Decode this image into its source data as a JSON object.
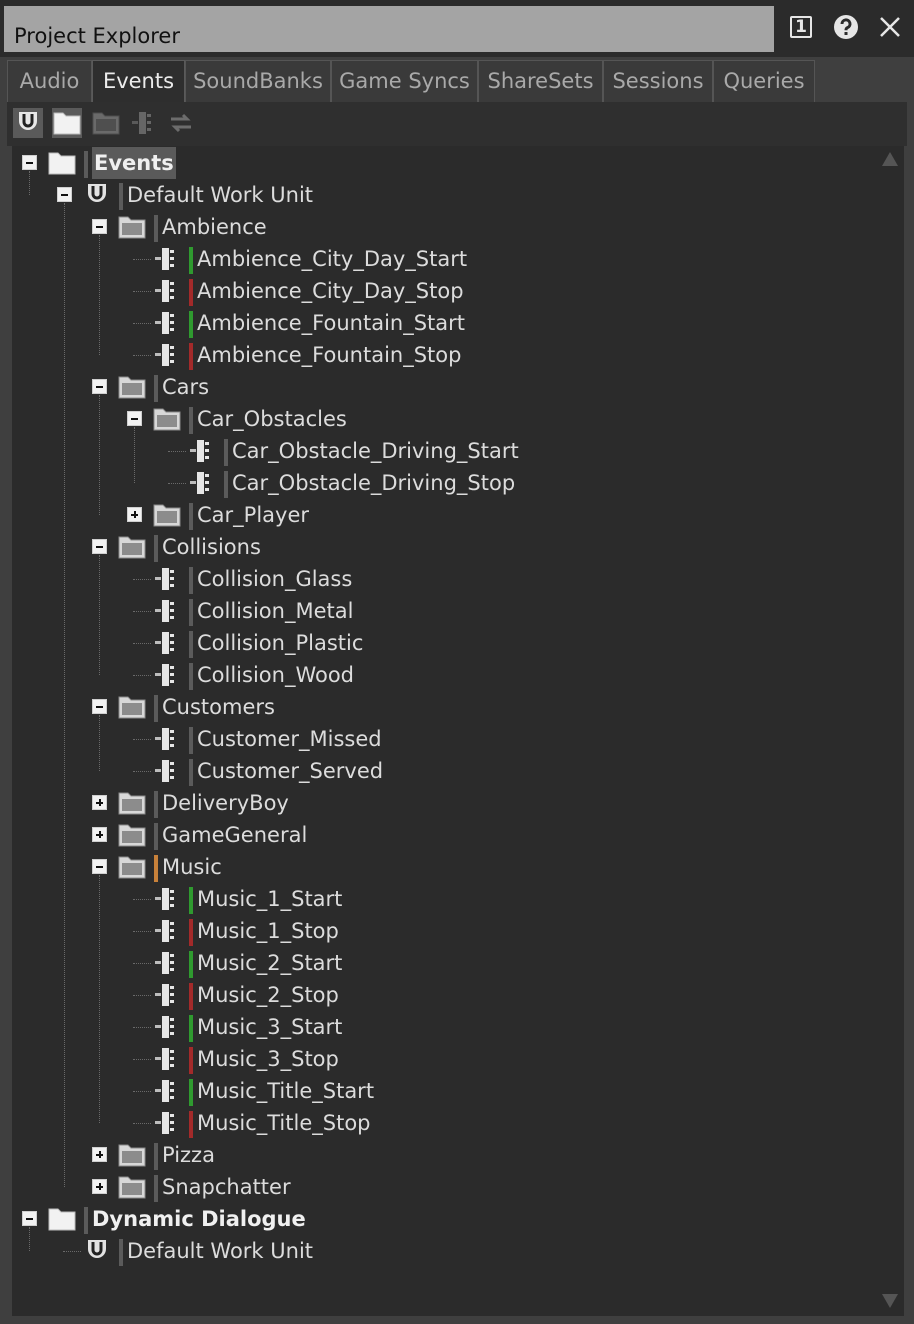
{
  "window": {
    "title": "Project Explorer",
    "float_badge": "1"
  },
  "tabs": [
    "Audio",
    "Events",
    "SoundBanks",
    "Game Syncs",
    "ShareSets",
    "Sessions",
    "Queries"
  ],
  "active_tab": "Events",
  "tree": {
    "events_root": "Events",
    "default_work_unit": "Default Work Unit",
    "ambience": {
      "label": "Ambience",
      "items": [
        "Ambience_City_Day_Start",
        "Ambience_City_Day_Stop",
        "Ambience_Fountain_Start",
        "Ambience_Fountain_Stop"
      ]
    },
    "cars": {
      "label": "Cars",
      "car_obstacles": {
        "label": "Car_Obstacles",
        "items": [
          "Car_Obstacle_Driving_Start",
          "Car_Obstacle_Driving_Stop"
        ]
      },
      "car_player": "Car_Player"
    },
    "collisions": {
      "label": "Collisions",
      "items": [
        "Collision_Glass",
        "Collision_Metal",
        "Collision_Plastic",
        "Collision_Wood"
      ]
    },
    "customers": {
      "label": "Customers",
      "items": [
        "Customer_Missed",
        "Customer_Served"
      ]
    },
    "delivery_boy": "DeliveryBoy",
    "game_general": "GameGeneral",
    "music": {
      "label": "Music",
      "items": [
        "Music_1_Start",
        "Music_1_Stop",
        "Music_2_Start",
        "Music_2_Stop",
        "Music_3_Start",
        "Music_3_Stop",
        "Music_Title_Start",
        "Music_Title_Stop"
      ]
    },
    "pizza": "Pizza",
    "snapchatter": "Snapchatter",
    "dynamic_dialogue_root": "Dynamic Dialogue",
    "dd_work_unit": "Default Work Unit"
  },
  "colors": {
    "start": "#2f9a2f",
    "stop": "#a32a2a",
    "music_folder": "#c8813a",
    "neutral": "#5b5b5b"
  }
}
